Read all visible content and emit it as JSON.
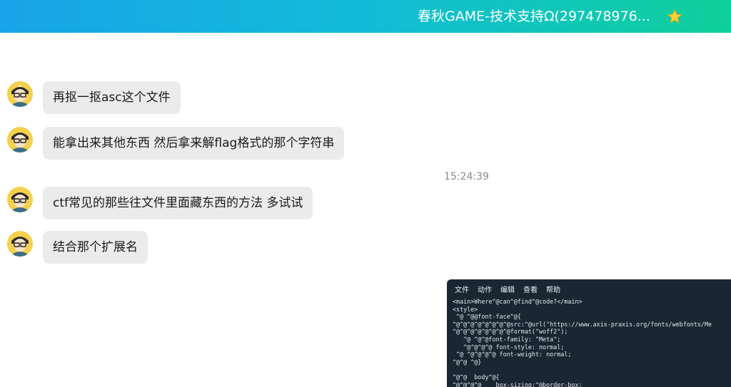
{
  "header": {
    "title": "春秋GAME-技术支持Ω(297478976...",
    "star_icon": "star-icon",
    "gradient_start": "#18a4e8",
    "gradient_end": "#0fcf9a"
  },
  "messages": [
    {
      "text": "再抠一抠asc这个文件",
      "avatar": "avatar-icon"
    },
    {
      "text": "能拿出来其他东西 然后拿来解flag格式的那个字符串",
      "avatar": "avatar-icon"
    },
    {
      "text": "ctf常见的那些往文件里面藏东西的方法 多试试",
      "avatar": "avatar-icon"
    },
    {
      "text": "结合那个扩展名",
      "avatar": "avatar-icon"
    }
  ],
  "timestamp": "15:24:39",
  "terminal": {
    "menu": [
      "文件",
      "动作",
      "编辑",
      "查看",
      "帮助"
    ],
    "lines": [
      "<main>Where^@can^@find^@code?</main>",
      "<style>",
      " ^@ ^@@font-face^@{",
      "^@^@^@^@^@^@^@^@src:^@url(\"https://www.axis-praxis.org/fonts/webfonts/Me",
      "^@^@^@^@^@^@^@^@format(\"woff2\");",
      "   ^@ ^@^@font-family: \"Meta\";",
      "   ^@^@^@^@ font-style: normal;",
      " ^@ ^@^@^@^@ font-weight: normal;",
      "^@^@ ^@}",
      "",
      "^@^@  body^@{",
      "^@^@^@^@    box-sizing:^@border-box;"
    ]
  },
  "colors": {
    "bubble_bg": "#ebebeb",
    "terminal_bg": "#1b2633"
  }
}
